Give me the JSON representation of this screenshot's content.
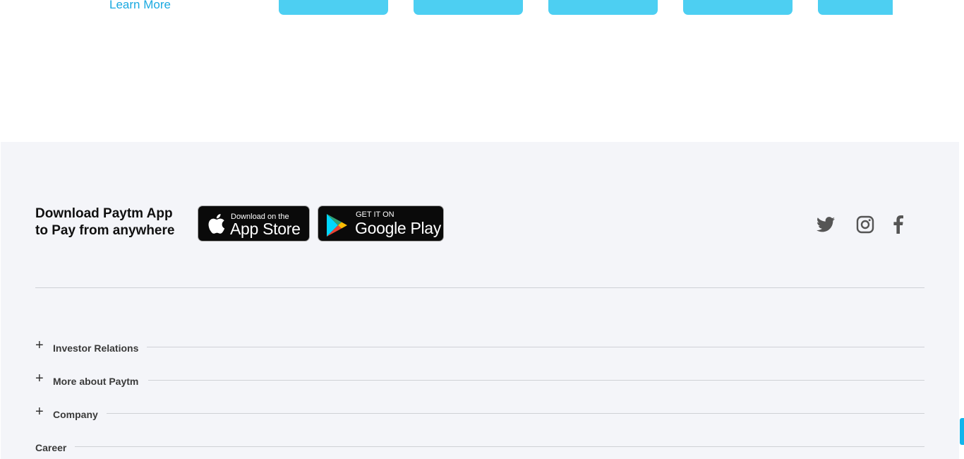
{
  "top": {
    "learn_more": "Learn More"
  },
  "footer": {
    "download_line1": "Download Paytm App",
    "download_line2": "to Pay from anywhere",
    "app_store": {
      "small": "Download on the",
      "big": "App Store"
    },
    "google_play": {
      "small": "GET IT ON",
      "big": "Google Play"
    },
    "social": [
      "twitter-icon",
      "instagram-icon",
      "facebook-icon"
    ],
    "links": [
      {
        "label": "Investor Relations",
        "expandable": true
      },
      {
        "label": "More about Paytm",
        "expandable": true
      },
      {
        "label": "Company",
        "expandable": true
      },
      {
        "label": "Career",
        "expandable": false
      }
    ]
  },
  "colors": {
    "accent": "#4dcff2",
    "link": "#1aa9e0",
    "footer_bg": "#f4f5f9",
    "scroll_indicator": "#12b5ec"
  }
}
